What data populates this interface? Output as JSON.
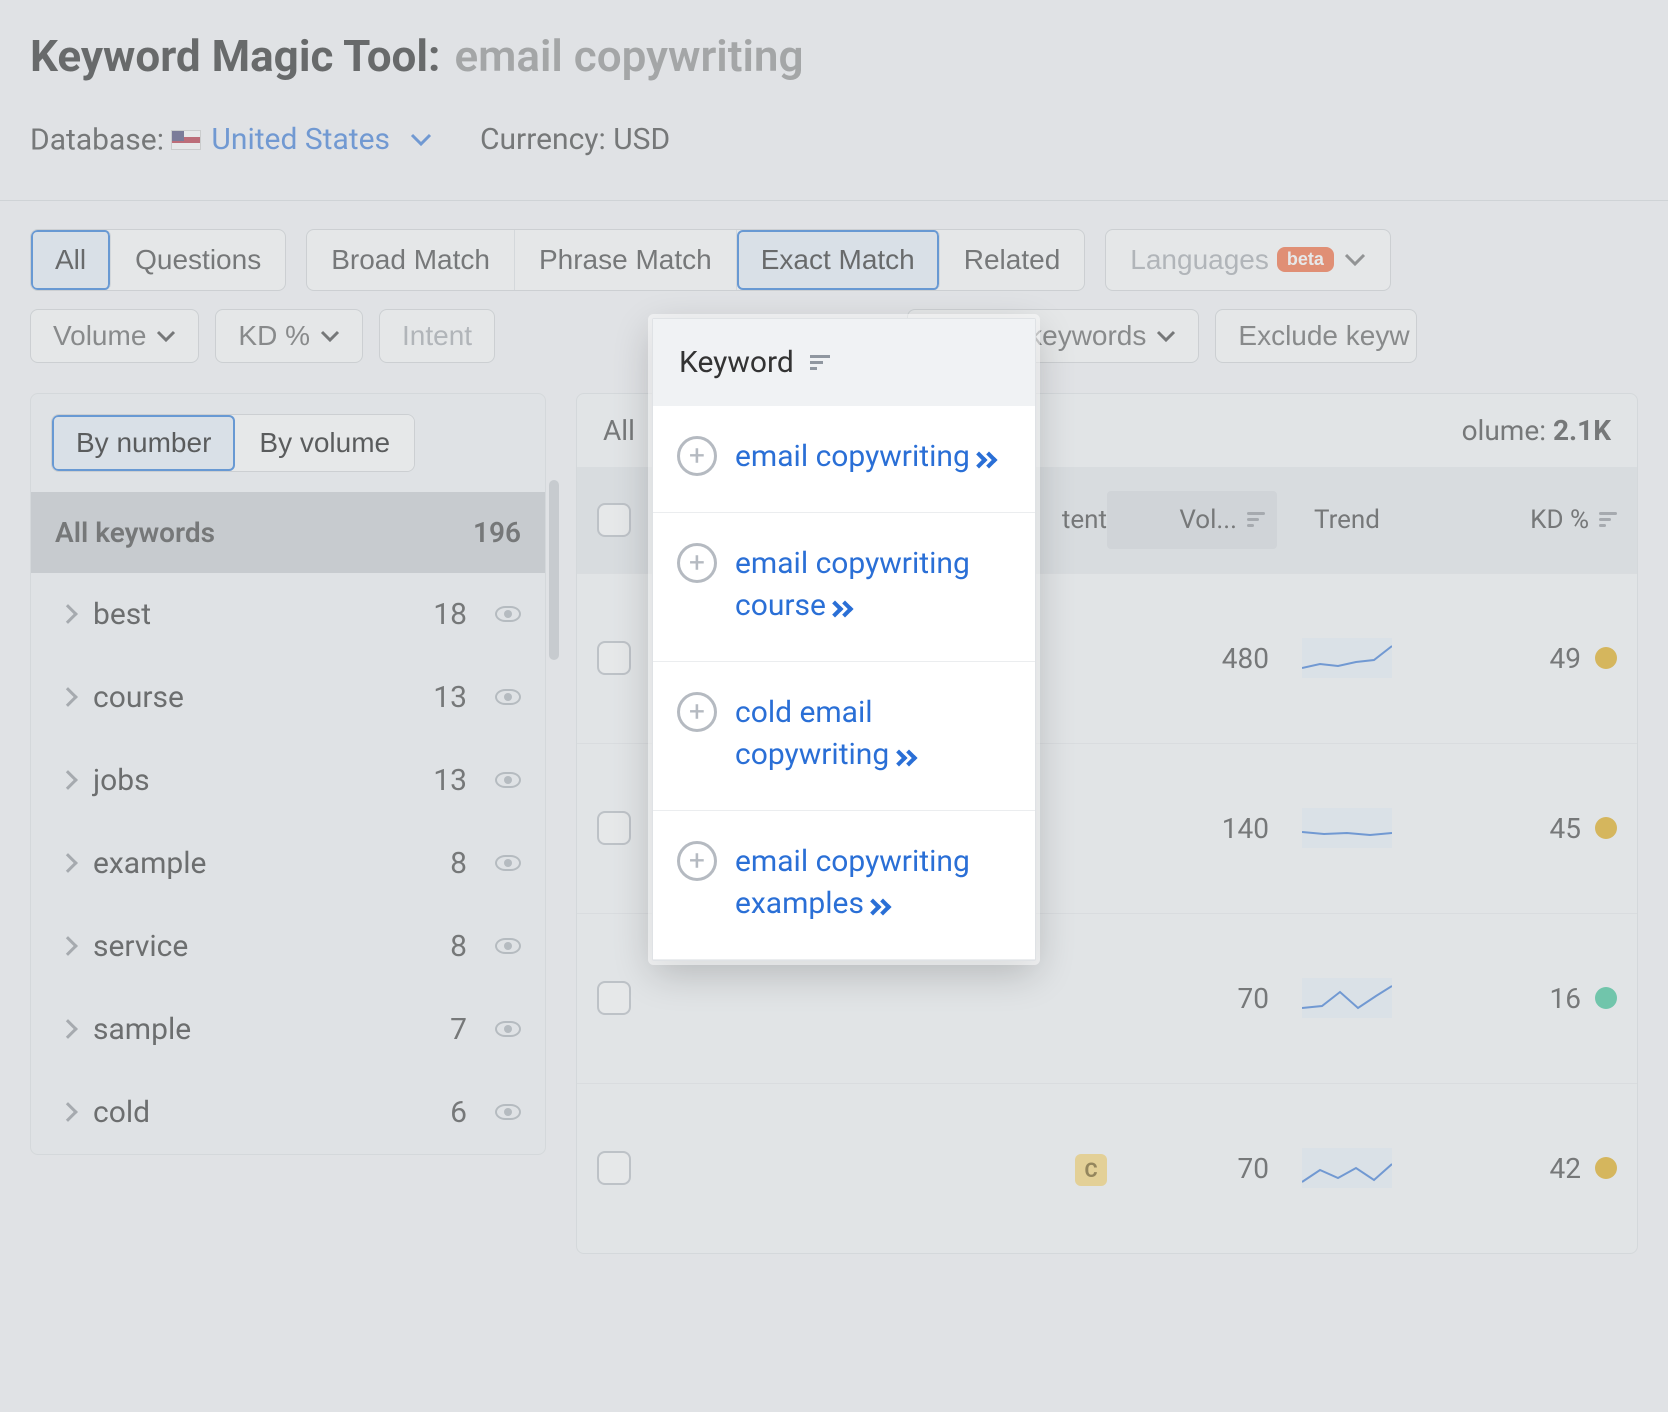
{
  "header": {
    "title": "Keyword Magic Tool:",
    "query": "email copywriting",
    "database_label": "Database:",
    "database_value": "United States",
    "currency_label": "Currency:",
    "currency_value": "USD"
  },
  "tabs": {
    "scope": [
      "All",
      "Questions"
    ],
    "scope_active": "All",
    "match": [
      "Broad Match",
      "Phrase Match",
      "Exact Match",
      "Related"
    ],
    "match_active": "Exact Match",
    "languages_label": "Languages",
    "beta": "beta"
  },
  "filters": {
    "volume": "Volume",
    "kd": "KD %",
    "intent": "Intent",
    "include": "Include keywords",
    "exclude": "Exclude keyw"
  },
  "sidebar": {
    "mode_by_number": "By number",
    "mode_by_volume": "By volume",
    "mode_active": "By number",
    "all_keywords_label": "All keywords",
    "all_keywords_count": "196",
    "groups": [
      {
        "label": "best",
        "count": "18"
      },
      {
        "label": "course",
        "count": "13"
      },
      {
        "label": "jobs",
        "count": "13"
      },
      {
        "label": "example",
        "count": "8"
      },
      {
        "label": "service",
        "count": "8"
      },
      {
        "label": "sample",
        "count": "7"
      },
      {
        "label": "cold",
        "count": "6"
      }
    ]
  },
  "results": {
    "summary_all_label": "All",
    "total_volume_label": "olume:",
    "total_volume_value": "2.1K",
    "columns": {
      "intent": "tent",
      "vol": "Vol...",
      "trend": "Trend",
      "kd": "KD %"
    },
    "rows": [
      {
        "vol": "480",
        "kd": "49",
        "kd_color": "#e0a400",
        "intent": ""
      },
      {
        "vol": "140",
        "kd": "45",
        "kd_color": "#e0a400",
        "intent": ""
      },
      {
        "vol": "70",
        "kd": "16",
        "kd_color": "#2ac08f",
        "intent": ""
      },
      {
        "vol": "70",
        "kd": "42",
        "kd_color": "#e0a400",
        "intent": "C"
      }
    ]
  },
  "keyword_column": {
    "header": "Keyword",
    "items": [
      "email copywriting",
      "email copywriting course",
      "cold email copywriting",
      "email copywriting examples"
    ]
  }
}
